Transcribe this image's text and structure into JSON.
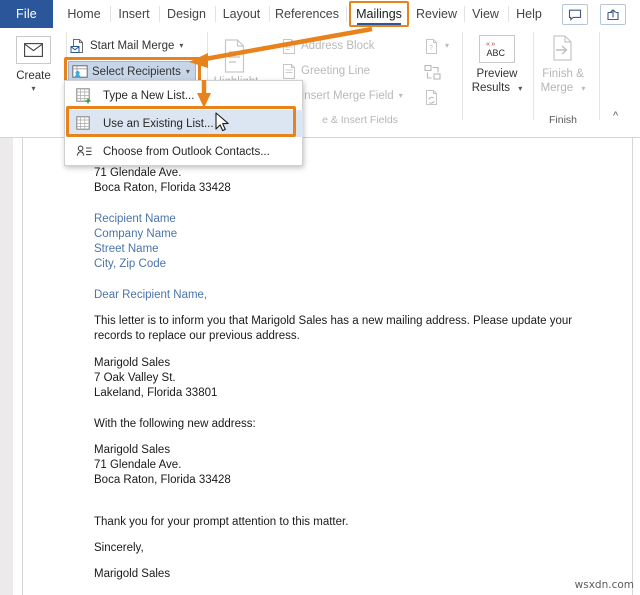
{
  "app": {
    "title": "Microsoft Word - Mailings ribbon",
    "accent_blue": "#2b579a",
    "highlight_orange": "#e8821a",
    "selected_fill": "#c6d5e8",
    "menu_hover_fill": "#dce6f2",
    "placeholder_text_color": "#4a75ab"
  },
  "ribbon": {
    "file_tab": "File",
    "tabs": [
      {
        "label": "Home",
        "active": false
      },
      {
        "label": "Insert",
        "active": false
      },
      {
        "label": "Design",
        "active": false
      },
      {
        "label": "Layout",
        "active": false
      },
      {
        "label": "References",
        "active": false
      },
      {
        "label": "Mailings",
        "active": true
      },
      {
        "label": "Review",
        "active": false
      },
      {
        "label": "View",
        "active": false
      },
      {
        "label": "Help",
        "active": false
      }
    ],
    "top_right_buttons": [
      {
        "name": "comment-button",
        "icon": "comment-icon"
      },
      {
        "name": "share-button",
        "icon": "share-icon"
      }
    ],
    "groups": [
      {
        "name": "create",
        "label": "Create",
        "big_button": {
          "label_line1": "Create",
          "icon": "envelope-icon",
          "has_dropdown": true
        }
      },
      {
        "name": "start-mail-merge",
        "label": "Start Mail Merge",
        "commands": [
          {
            "label": "Start Mail Merge",
            "icon": "start-mail-merge-icon",
            "has_dropdown": true,
            "disabled": false
          },
          {
            "label": "Select Recipients",
            "icon": "select-recipients-icon",
            "has_dropdown": true,
            "disabled": false,
            "pressed": true,
            "highlighted": true
          },
          {
            "label": "Highlight",
            "icon": "edit-recipient-list-icon",
            "has_dropdown": false,
            "disabled": true
          }
        ]
      },
      {
        "name": "write-insert-fields",
        "label": "e & Insert Fields",
        "commands": [
          {
            "label": "Address Block",
            "icon": "address-block-icon",
            "disabled": true
          },
          {
            "label": "Greeting Line",
            "icon": "greeting-line-icon",
            "disabled": true
          },
          {
            "label": "Insert Merge Field",
            "icon": "insert-merge-field-icon",
            "has_dropdown": true,
            "disabled": true
          }
        ],
        "icon_column": [
          {
            "name": "rules-icon",
            "has_dropdown": true,
            "disabled": true
          },
          {
            "name": "match-fields-icon",
            "disabled": true
          },
          {
            "name": "update-labels-icon",
            "disabled": true
          }
        ]
      },
      {
        "name": "preview-results",
        "label": "",
        "big_button": {
          "label_line1": "Preview",
          "label_line2": "Results",
          "icon": "abc-preview-icon",
          "has_dropdown": true,
          "disabled": false
        }
      },
      {
        "name": "finish",
        "label": "Finish",
        "big_button": {
          "label_line1": "Finish &",
          "label_line2": "Merge",
          "icon": "finish-merge-icon",
          "has_dropdown": true,
          "disabled": true
        }
      }
    ],
    "collapse_ribbon_icon": "chevron-up-icon"
  },
  "dropdown": {
    "name": "select-recipients-menu",
    "items": [
      {
        "label": "Type a New List...",
        "icon": "new-list-icon",
        "underline_char": "N",
        "highlighted": false
      },
      {
        "label": "Use an Existing List...",
        "icon": "existing-list-icon",
        "underline_char": "e",
        "highlighted": true
      },
      {
        "label": "Choose from Outlook Contacts...",
        "icon": "outlook-contacts-icon",
        "underline_char": "o",
        "highlighted": false
      }
    ]
  },
  "annotations": [
    {
      "name": "arrow-to-select-recipients",
      "from": "Mailings tab",
      "to": "Select Recipients button"
    },
    {
      "name": "arrow-to-use-existing-list",
      "from": "menu top",
      "to": "Use an Existing List item"
    }
  ],
  "document": {
    "blocks": [
      {
        "type": "plain",
        "lines": [
          "71 Glendale Ave.",
          "Boca Raton, Florida 33428"
        ]
      },
      {
        "type": "gap"
      },
      {
        "type": "placeholder",
        "lines": [
          "Recipient Name",
          "Company Name",
          "Street Name",
          "City, Zip Code"
        ]
      },
      {
        "type": "gap"
      },
      {
        "type": "placeholder",
        "lines": [
          "Dear Recipient Name,"
        ]
      },
      {
        "type": "gap-sm"
      },
      {
        "type": "plain",
        "lines": [
          "This letter is to inform you that Marigold Sales has a new mailing address. Please update your records to replace our previous address."
        ]
      },
      {
        "type": "gap-sm"
      },
      {
        "type": "plain",
        "lines": [
          "Marigold Sales",
          "7 Oak Valley St.",
          "Lakeland, Florida 33801"
        ]
      },
      {
        "type": "gap"
      },
      {
        "type": "plain",
        "lines": [
          "With the following new address:"
        ]
      },
      {
        "type": "gap-sm"
      },
      {
        "type": "plain",
        "lines": [
          "Marigold Sales",
          "71 Glendale Ave.",
          "Boca Raton, Florida 33428"
        ]
      },
      {
        "type": "gap"
      },
      {
        "type": "plain",
        "lines": [
          "Thank you for your prompt attention to this matter."
        ]
      },
      {
        "type": "gap-sm"
      },
      {
        "type": "plain",
        "lines": [
          "Sincerely,"
        ]
      },
      {
        "type": "gap-sm"
      },
      {
        "type": "plain",
        "lines": [
          "Marigold Sales"
        ]
      }
    ],
    "line_1": "71 Glendale Ave.",
    "line_2": "Boca Raton, Florida 33428",
    "ph_1": "Recipient Name",
    "ph_2": "Company Name",
    "ph_3": "Street Name",
    "ph_4": "City, Zip Code",
    "salutation": "Dear Recipient Name,",
    "body_para": "This letter is to inform you that Marigold Sales has a new mailing address. Please update your records to replace our previous address.",
    "old_addr_1": "Marigold Sales",
    "old_addr_2": "7 Oak Valley St.",
    "old_addr_3": "Lakeland, Florida 33801",
    "new_addr_intro": "With the following new address:",
    "new_addr_1": "Marigold Sales",
    "new_addr_2": "71 Glendale Ave.",
    "new_addr_3": "Boca Raton, Florida 33428",
    "thanks": "Thank you for your prompt attention to this matter.",
    "closing": "Sincerely,",
    "signature": "Marigold Sales"
  },
  "watermark": "wsxdn.com"
}
